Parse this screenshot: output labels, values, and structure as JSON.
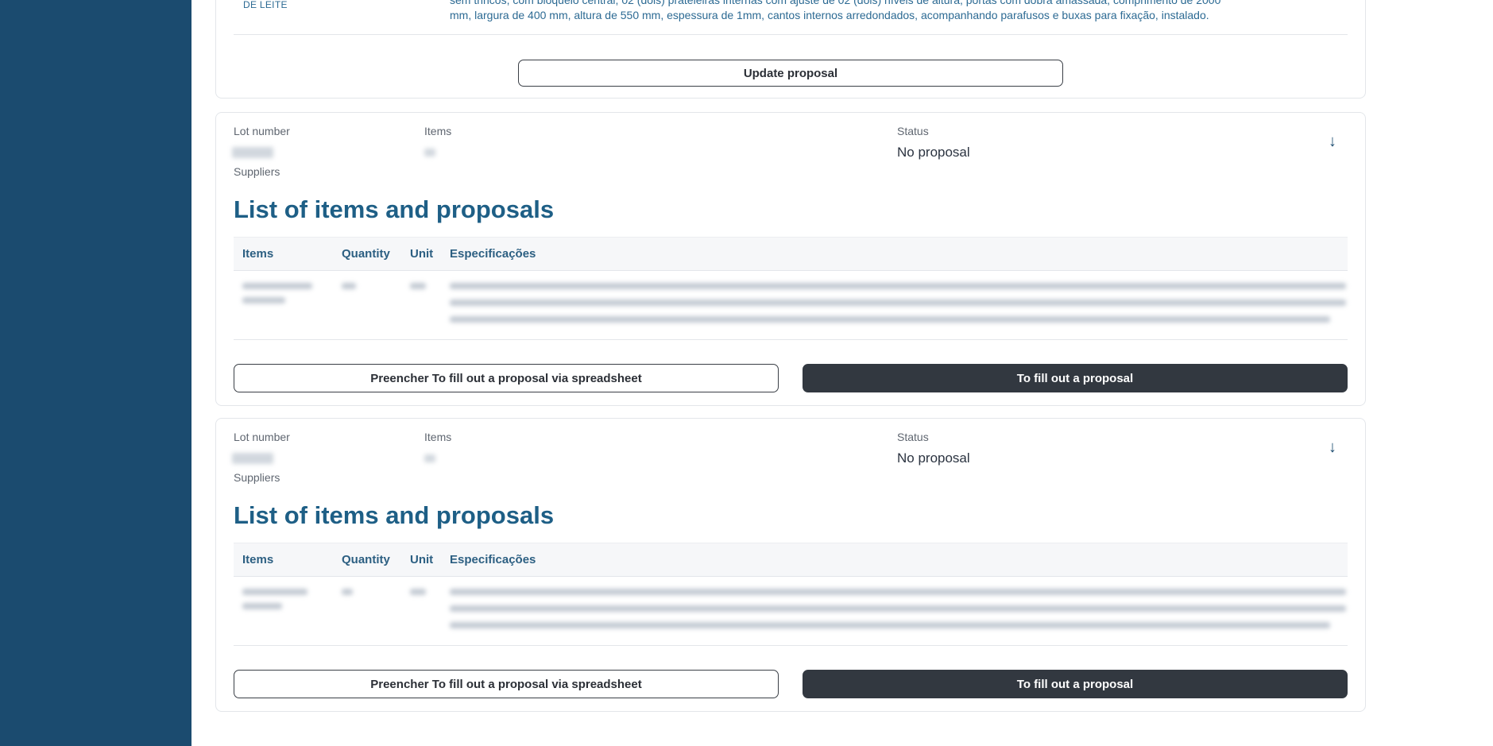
{
  "previous_lot": {
    "lot_fragment": "DE LEITE",
    "spec_lines": [
      "sem trincos, com bloqueio central, 02 (dois) prateleiras internas com ajuste de 02 (dois) níveis de altura, portas com dobra amassada, comprimento de 2000",
      "mm, largura de 400 mm, altura de 550 mm, espessura de 1mm, cantos internos arredondados, acompanhando parafusos e buxas para fixação, instalado."
    ],
    "update_button": "Update proposal"
  },
  "lots": [
    {
      "lot_number_label": "Lot number",
      "items_label": "Items",
      "status_label": "Status",
      "status_value": "No proposal",
      "suppliers_label": "Suppliers",
      "expand_icon": "arrow-down-icon",
      "list_title": "List of items and proposals",
      "columns": [
        "Items",
        "Quantity",
        "Unit",
        "Especificações"
      ],
      "spreadsheet_button": "Preencher To fill out a proposal via spreadsheet",
      "fill_button": "To fill out a proposal"
    },
    {
      "lot_number_label": "Lot number",
      "items_label": "Items",
      "status_label": "Status",
      "status_value": "No proposal",
      "suppliers_label": "Suppliers",
      "expand_icon": "arrow-down-icon",
      "list_title": "List of items and proposals",
      "columns": [
        "Items",
        "Quantity",
        "Unit",
        "Especificações"
      ],
      "spreadsheet_button": "Preencher To fill out a proposal via spreadsheet",
      "fill_button": "To fill out a proposal"
    }
  ],
  "colors": {
    "sidebar": "#1b4b6f",
    "title": "#1e5f86",
    "dark_button": "#323840"
  }
}
